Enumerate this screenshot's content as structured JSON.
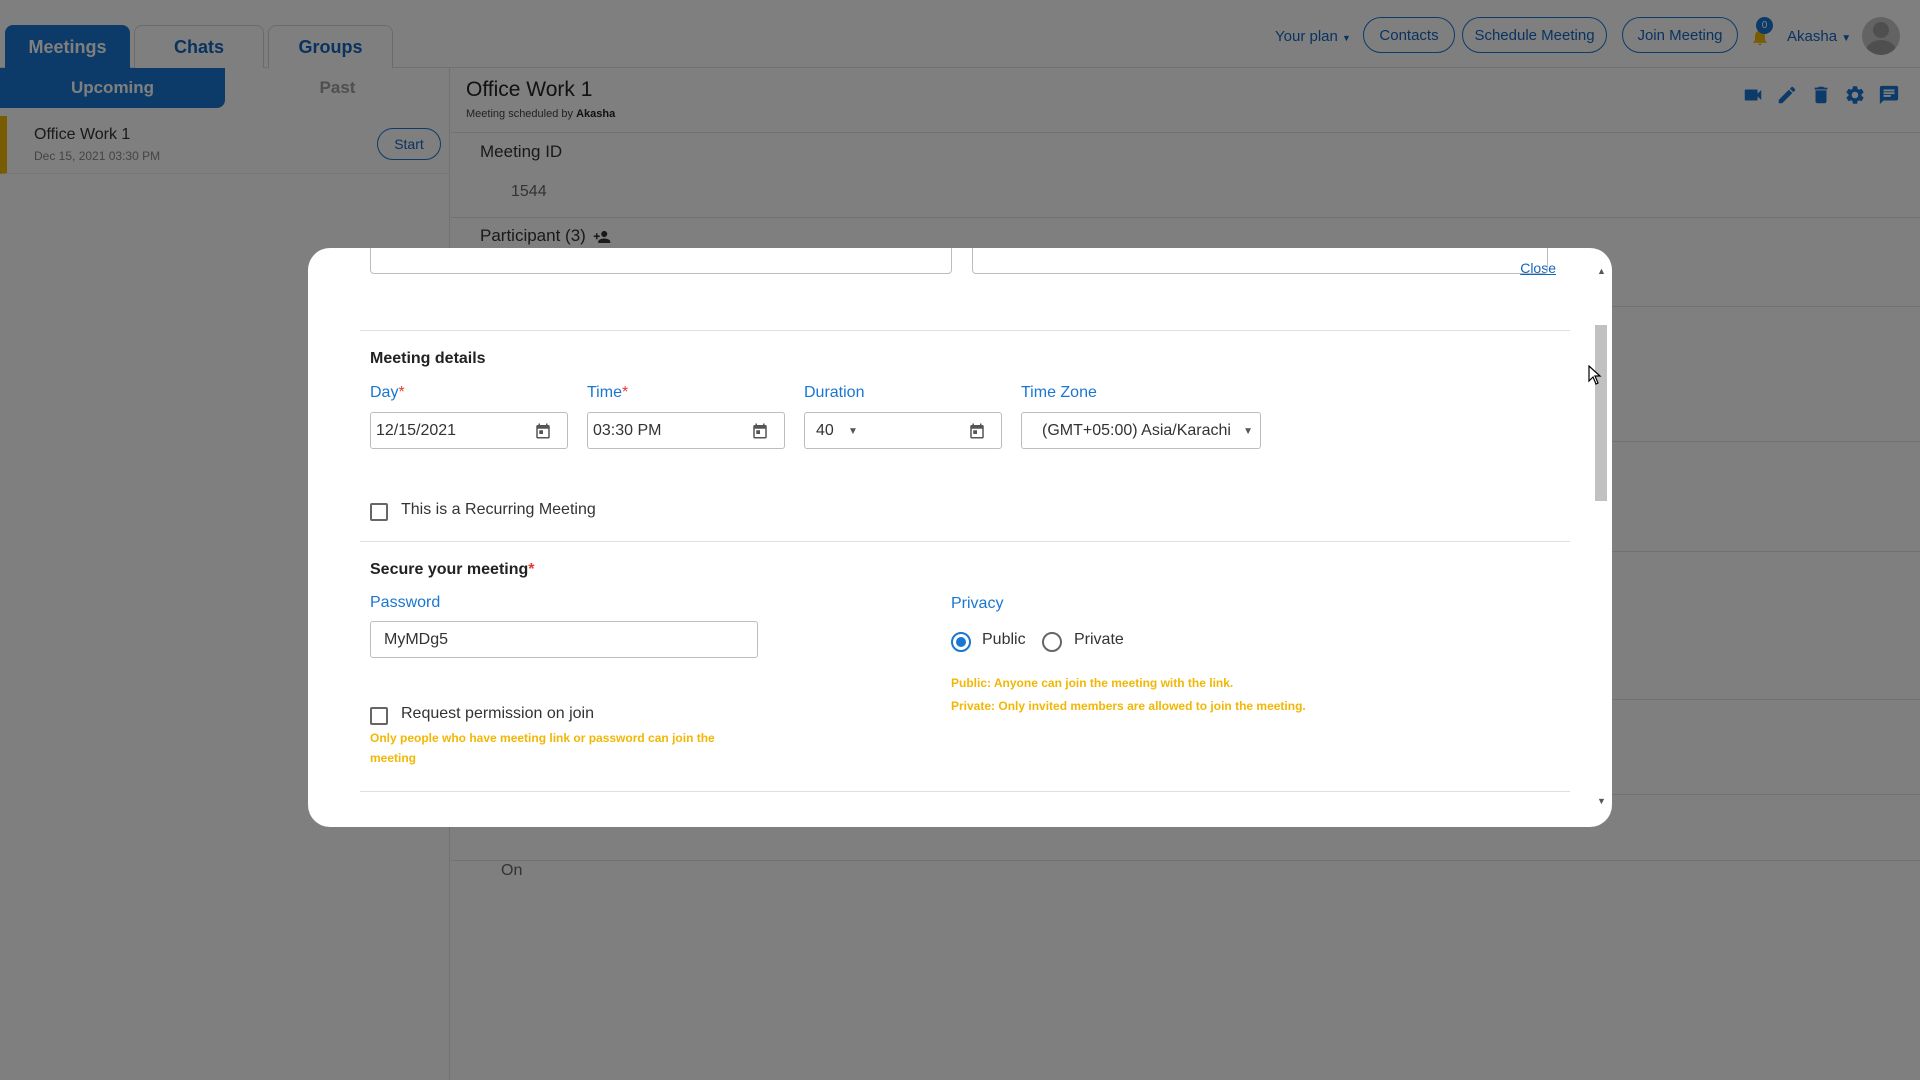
{
  "header": {
    "tabs": [
      {
        "label": "Meetings",
        "active": true
      },
      {
        "label": "Chats",
        "active": false
      },
      {
        "label": "Groups",
        "active": false
      }
    ],
    "your_plan": "Your plan",
    "contacts_button": "Contacts",
    "schedule_button": "Schedule Meeting",
    "join_button": "Join Meeting",
    "notification_count": "0",
    "user_name": "Akasha"
  },
  "sidebar": {
    "tabs": [
      {
        "label": "Upcoming",
        "active": true
      },
      {
        "label": "Past",
        "active": false
      }
    ],
    "meetings": [
      {
        "name": "Office Work 1",
        "date": "Dec 15, 2021 03:30 PM",
        "action": "Start"
      }
    ]
  },
  "main": {
    "title": "Office Work 1",
    "scheduled_by_prefix": "Meeting scheduled by",
    "scheduled_by_name": "Akasha",
    "meeting_id_label": "Meeting ID",
    "meeting_id_value": "1544",
    "participant_label": "Participant (3)",
    "bottom_value": "On"
  },
  "modal": {
    "close": "Close",
    "meeting_details_title": "Meeting details",
    "day_label": "Day",
    "day_value": "12/15/2021",
    "time_label": "Time",
    "time_value": "03:30 PM",
    "duration_label": "Duration",
    "duration_value": "40",
    "timezone_label": "Time Zone",
    "timezone_value": "(GMT+05:00) Asia/Karachi",
    "recurring_label": "This is a Recurring Meeting",
    "recurring_checked": false,
    "secure_title": "Secure your meeting",
    "password_label": "Password",
    "password_value": "MyMDg5",
    "request_permission_label": "Request permission on join",
    "request_permission_checked": false,
    "request_permission_hint": "Only people who have meeting link or password can join the meeting",
    "privacy_label": "Privacy",
    "privacy_options": [
      {
        "label": "Public",
        "selected": true
      },
      {
        "label": "Private",
        "selected": false
      }
    ],
    "privacy_hint_public": "Public: Anyone can join the meeting with the link.",
    "privacy_hint_private": "Private: Only invited members are allowed to join the meeting."
  },
  "colors": {
    "primary": "#1976d2",
    "accent_yellow": "#f2b705",
    "required_red": "#e53935",
    "overlay": "rgba(0,0,0,0.5)"
  }
}
